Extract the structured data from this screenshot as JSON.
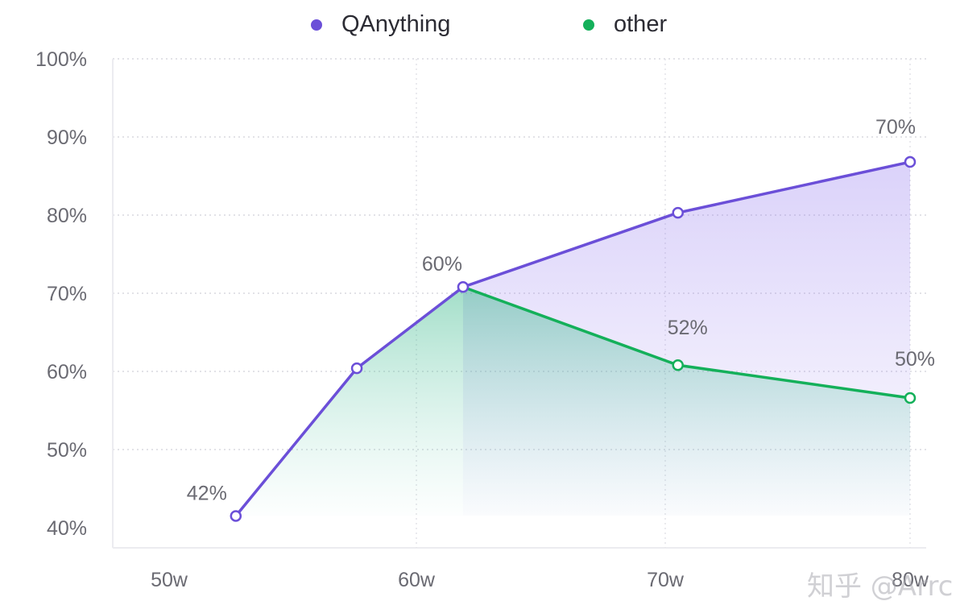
{
  "chart_data": {
    "type": "area",
    "x_ticks": [
      "50w",
      "60w",
      "70w",
      "80w"
    ],
    "y_ticks": [
      "100%",
      "90%",
      "80%",
      "70%",
      "60%",
      "50%",
      "40%"
    ],
    "ylim": [
      40,
      100
    ],
    "xlim": [
      50,
      80
    ],
    "grid": true,
    "legend_position": "top",
    "series": [
      {
        "name": "QAnything",
        "color": "#6b4fd8",
        "points": [
          {
            "x": 52.7,
            "y": 41.5,
            "label": "42%"
          },
          {
            "x": 57.6,
            "y": 60.4,
            "label": ""
          },
          {
            "x": 61.9,
            "y": 70.8,
            "label": "60%"
          },
          {
            "x": 70.6,
            "y": 80.3,
            "label": ""
          },
          {
            "x": 80.0,
            "y": 86.8,
            "label": "70%"
          }
        ]
      },
      {
        "name": "other",
        "color": "#14b05a",
        "points": [
          {
            "x": 61.9,
            "y": 70.8,
            "label": ""
          },
          {
            "x": 70.6,
            "y": 60.8,
            "label": "52%"
          },
          {
            "x": 80.0,
            "y": 56.6,
            "label": "50%"
          }
        ]
      }
    ]
  },
  "watermark": "知乎 @Arrc"
}
